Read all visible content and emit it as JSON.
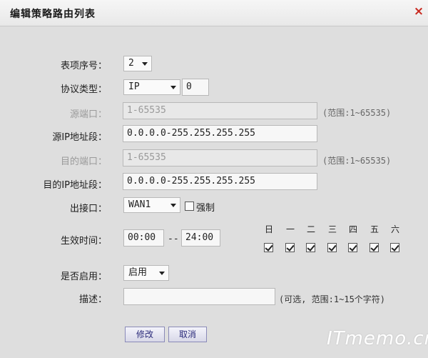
{
  "dialog": {
    "title": "编辑策略路由列表",
    "close_label": "×"
  },
  "form": {
    "entry_index": {
      "label": "表项序号：",
      "value": "2"
    },
    "protocol": {
      "label": "协议类型：",
      "value": "IP",
      "extra_value": "0"
    },
    "src_port": {
      "label": "源端口：",
      "value": "1-65535",
      "hint": "(范围:1~65535)"
    },
    "src_ip": {
      "label": "源IP地址段：",
      "value": "0.0.0.0-255.255.255.255"
    },
    "dst_port": {
      "label": "目的端口：",
      "value": "1-65535",
      "hint": "(范围:1~65535)"
    },
    "dst_ip": {
      "label": "目的IP地址段：",
      "value": "0.0.0.0-255.255.255.255"
    },
    "outbound": {
      "label": "出接口：",
      "value": "WAN1",
      "force_label": "强制",
      "force_checked": false
    },
    "schedule": {
      "label": "生效时间：",
      "start": "00:00",
      "separator": "--",
      "end": "24:00",
      "days": [
        {
          "name": "日",
          "checked": true
        },
        {
          "name": "一",
          "checked": true
        },
        {
          "name": "二",
          "checked": true
        },
        {
          "name": "三",
          "checked": true
        },
        {
          "name": "四",
          "checked": true
        },
        {
          "name": "五",
          "checked": true
        },
        {
          "name": "六",
          "checked": true
        }
      ]
    },
    "enabled": {
      "label": "是否启用：",
      "value": "启用"
    },
    "description": {
      "label": "描述：",
      "value": "",
      "hint": "(可选, 范围:1~15个字符)"
    }
  },
  "buttons": {
    "modify": "修改",
    "cancel": "取消"
  },
  "watermark": "ITmemo.cn",
  "colors": {
    "close": "#c8281e",
    "button_text": "#2a2a7a"
  }
}
